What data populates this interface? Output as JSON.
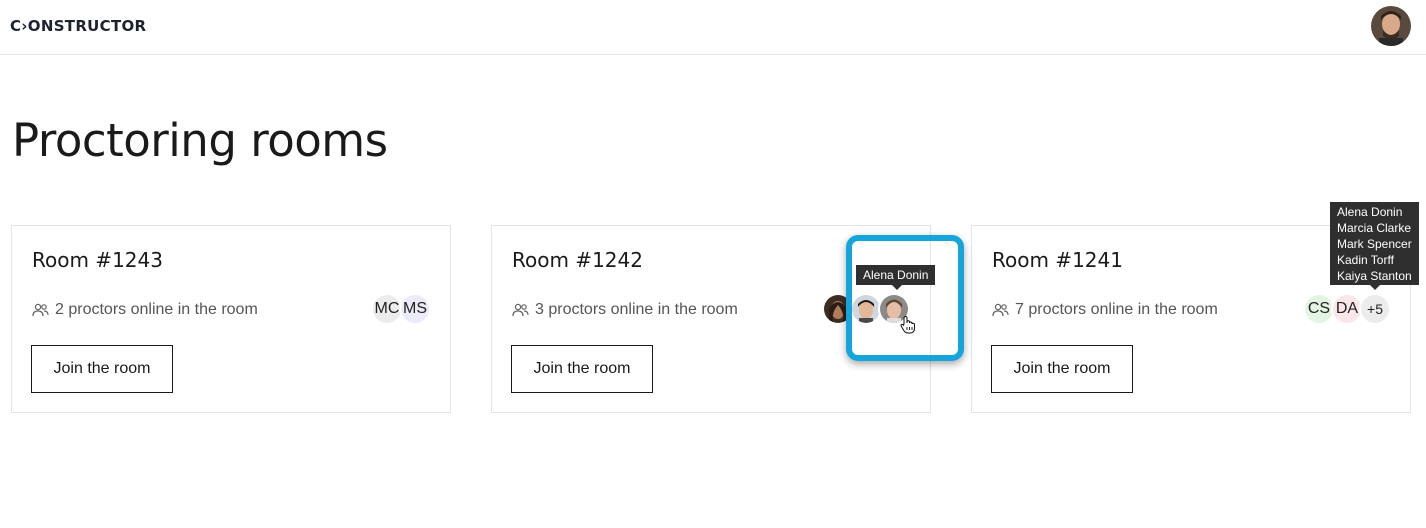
{
  "header": {
    "logo_text": "C›ONSTRUCTOR",
    "avatar_icon": "user-avatar-photo"
  },
  "page": {
    "title": "Proctoring rooms"
  },
  "rooms": [
    {
      "title": "Room #1243",
      "proctors_text": "2 proctors online in the room",
      "join_label": "Join the room",
      "avatars": [
        {
          "initials": "MC",
          "color": "#ececec"
        },
        {
          "initials": "MS",
          "color": "#ecebfa"
        }
      ]
    },
    {
      "title": "Room #1242",
      "proctors_text": "3 proctors online in the room",
      "join_label": "Join the room",
      "avatars": [
        {
          "icon": "proctor-photo-1"
        },
        {
          "icon": "proctor-photo-2"
        },
        {
          "icon": "proctor-photo-3"
        }
      ],
      "tooltip": "Alena Donin"
    },
    {
      "title": "Room #1241",
      "proctors_text": "7 proctors online in the room",
      "join_label": "Join the room",
      "avatars": [
        {
          "initials": "CS",
          "color": "#e3f4e3"
        },
        {
          "initials": "DA",
          "color": "#fbe6ea"
        },
        {
          "initials": "+5",
          "color": "#ececec"
        }
      ],
      "tooltip_list": [
        "Alena Donin",
        "Marcia Clarke",
        "Mark Spencer",
        "Kadin Torff",
        "Kaiya Stanton"
      ]
    }
  ],
  "colors": {
    "highlight": "#15a5dc",
    "tooltip_bg": "#2f2f2f"
  }
}
